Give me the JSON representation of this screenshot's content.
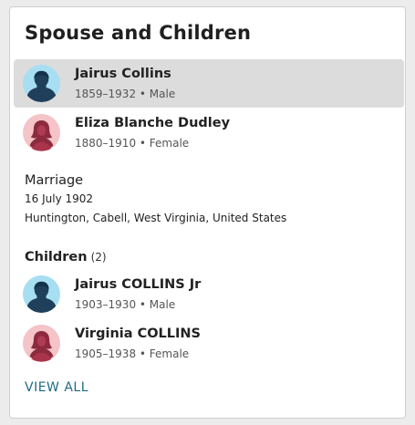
{
  "section": {
    "title": "Spouse and Children"
  },
  "parents": [
    {
      "name": "Jairus Collins",
      "years": "1859–1932",
      "sex": "Male"
    },
    {
      "name": "Eliza Blanche Dudley",
      "years": "1880–1910",
      "sex": "Female"
    }
  ],
  "marriage": {
    "label": "Marriage",
    "date": "16 July 1902",
    "place": "Huntington, Cabell, West Virginia, United States"
  },
  "children": {
    "label": "Children",
    "count": "(2)",
    "items": [
      {
        "name": "Jairus COLLINS Jr",
        "years": "1903–1930",
        "sex": "Male"
      },
      {
        "name": "Virginia COLLINS",
        "years": "1905–1938",
        "sex": "Female"
      }
    ],
    "view_all": "VIEW ALL"
  },
  "colors": {
    "male_avatar_bg": "#a7def2",
    "female_avatar_bg": "#f4c4c8",
    "link": "#1e6a82",
    "highlight_row": "#dcdcdc"
  },
  "separator": " • "
}
